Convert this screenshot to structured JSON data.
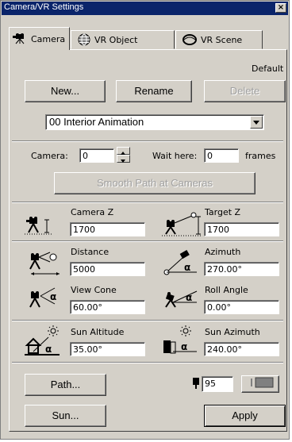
{
  "window": {
    "title": "Camera/VR Settings",
    "close_glyph": "×"
  },
  "tabs": [
    {
      "label": "Camera",
      "icon": "camera-icon",
      "active": true
    },
    {
      "label": "VR Object",
      "icon": "globe-icon",
      "active": false
    },
    {
      "label": "VR Scene",
      "icon": "vr-scene-icon",
      "active": false
    }
  ],
  "preset": {
    "default_label": "Default",
    "new_label": "New...",
    "rename_label": "Rename",
    "delete_label": "Delete",
    "selected": "00  Interior Animation"
  },
  "camera_row": {
    "camera_label": "Camera:",
    "camera_value": "0",
    "wait_label": "Wait here:",
    "wait_value": "0",
    "frames_label": "frames"
  },
  "smooth_path_label": "Smooth Path at Cameras",
  "params": {
    "camera_z": {
      "label": "Camera Z",
      "value": "1700"
    },
    "target_z": {
      "label": "Target Z",
      "value": "1700"
    },
    "distance": {
      "label": "Distance",
      "value": "5000"
    },
    "azimuth": {
      "label": "Azimuth",
      "value": "270.00°"
    },
    "view_cone": {
      "label": "View Cone",
      "value": "60.00°"
    },
    "roll_angle": {
      "label": "Roll Angle",
      "value": "0.00°"
    },
    "sun_altitude": {
      "label": "Sun Altitude",
      "value": "35.00°"
    },
    "sun_azimuth": {
      "label": "Sun Azimuth",
      "value": "240.00°"
    }
  },
  "bottom": {
    "path_label": "Path...",
    "sun_label": "Sun...",
    "apply_label": "Apply",
    "frame_rate_value": "95"
  },
  "colors": {
    "titlebar": "#0a246a",
    "face": "#d4d0c8"
  }
}
